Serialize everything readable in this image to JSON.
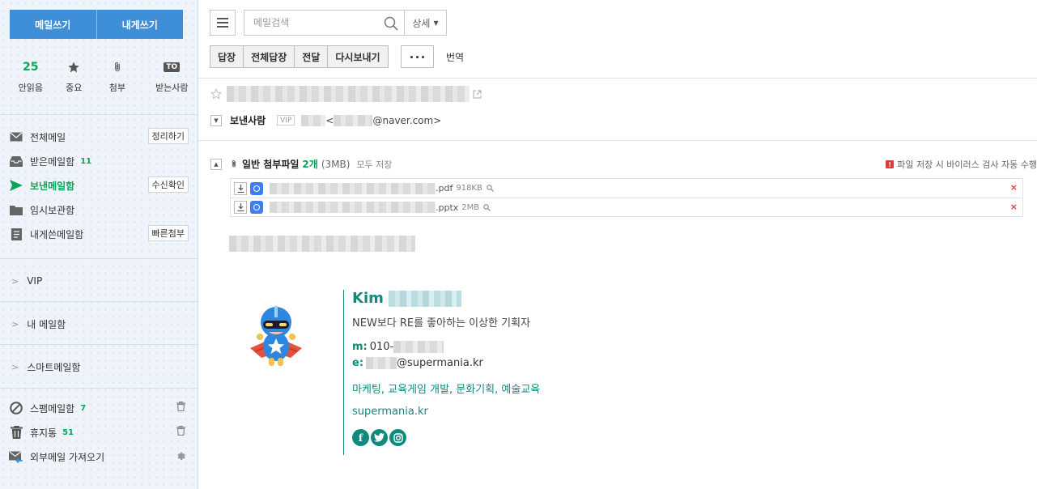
{
  "sidebar": {
    "compose_label": "메일쓰기",
    "self_compose_label": "내게쓰기",
    "quick": [
      {
        "count": "25",
        "label": "안읽음"
      },
      {
        "icon": "star-icon",
        "label": "중요"
      },
      {
        "icon": "paperclip-icon",
        "label": "첨부"
      },
      {
        "badge": "TO",
        "label": "받는사람"
      }
    ],
    "folders": [
      {
        "label": "전체메일",
        "icon": "envelope-icon",
        "button": "정리하기"
      },
      {
        "label": "받은메일함",
        "icon": "inbox-icon",
        "count": "11"
      },
      {
        "label": "보낸메일함",
        "icon": "send-icon",
        "button": "수신확인",
        "active": true
      },
      {
        "label": "임시보관함",
        "icon": "folder-icon"
      },
      {
        "label": "내게쓴메일함",
        "icon": "note-icon",
        "button": "빠른첨부"
      }
    ],
    "groups": [
      "VIP",
      "내 메일함",
      "스마트메일함"
    ],
    "bottom_folders": [
      {
        "label": "스팸메일함",
        "icon": "ban-icon",
        "count": "7"
      },
      {
        "label": "휴지통",
        "icon": "trash-icon",
        "count": "51"
      },
      {
        "label": "외부메일 가져오기",
        "icon": "import-mail-icon"
      }
    ]
  },
  "toolbar": {
    "search_placeholder": "메일검색",
    "detail_label": "상세",
    "actions": [
      "답장",
      "전체답장",
      "전달",
      "다시보내기"
    ],
    "translate_label": "번역"
  },
  "message": {
    "sender_label": "보낸사람",
    "vip_badge": "VIP",
    "sender_domain": "@naver.com",
    "attachments_title": "일반 첨부파일",
    "attachments_count": "2개",
    "attachments_size": "(3MB)",
    "save_all": "모두 저장",
    "virus_note": "파일 저장 시 바이러스 검사 자동 수행",
    "files": [
      {
        "ext": ".pdf",
        "size": "918KB"
      },
      {
        "ext": ".pptx",
        "size": "2MB"
      }
    ]
  },
  "signature": {
    "name": "Kim",
    "tagline": "NEW보다 RE를 좋아하는 이상한 기획자",
    "phone_key": "m:",
    "phone_prefix": "010-",
    "email_key": "e:",
    "email_domain": "@supermania.kr",
    "skills": "마케팅, 교육게임 개발, 문화기획, 예술교육",
    "website": "supermania.kr",
    "social": [
      "f",
      "t",
      "ig"
    ]
  },
  "colors": {
    "compose_blue": "#3e8fd8",
    "accent_green": "#0aa55a",
    "signature_teal": "#118a7e",
    "warning_red": "#e03b3b"
  }
}
